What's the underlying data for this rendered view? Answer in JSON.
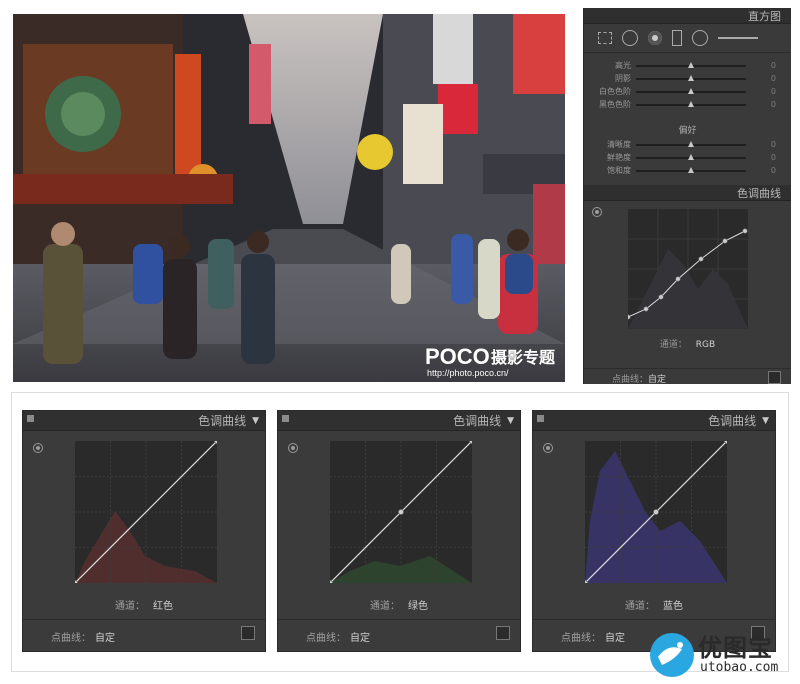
{
  "photo": {
    "watermark_brand": "POCO",
    "watermark_title": "摄影专题",
    "watermark_url": "http://photo.poco.cn/"
  },
  "lr_panel": {
    "top_header": "直方图",
    "sliders_a": [
      {
        "label": "高光",
        "value": "0",
        "pos": 0.5
      },
      {
        "label": "阴影",
        "value": "0",
        "pos": 0.5
      },
      {
        "label": "白色色阶",
        "value": "0",
        "pos": 0.5
      },
      {
        "label": "黑色色阶",
        "value": "0",
        "pos": 0.5
      }
    ],
    "presence_label": "偏好",
    "sliders_b": [
      {
        "label": "清晰度",
        "value": "0",
        "pos": 0.5
      },
      {
        "label": "鲜艳度",
        "value": "0",
        "pos": 0.5
      },
      {
        "label": "饱和度",
        "value": "0",
        "pos": 0.5
      }
    ],
    "curve_header": "色调曲线",
    "channel_label": "通道：",
    "channel_value": "RGB",
    "point_curve_label": "点曲线：",
    "point_curve_value": "自定"
  },
  "curve_panels": [
    {
      "title": "色调曲线",
      "channel_label": "通道：",
      "channel_value": "红色",
      "point_curve_label": "点曲线：",
      "point_curve_value": "自定",
      "hist_color": "#5a3030"
    },
    {
      "title": "色调曲线",
      "channel_label": "通道：",
      "channel_value": "绿色",
      "point_curve_label": "点曲线：",
      "point_curve_value": "自定",
      "hist_color": "#2f4a30"
    },
    {
      "title": "色调曲线",
      "channel_label": "通道：",
      "channel_value": "蓝色",
      "point_curve_label": "点曲线：",
      "point_curve_value": "自定",
      "hist_color": "#3a3670"
    }
  ],
  "watermark": {
    "text_cn": "优图宝",
    "text_en": "utobao.com"
  }
}
